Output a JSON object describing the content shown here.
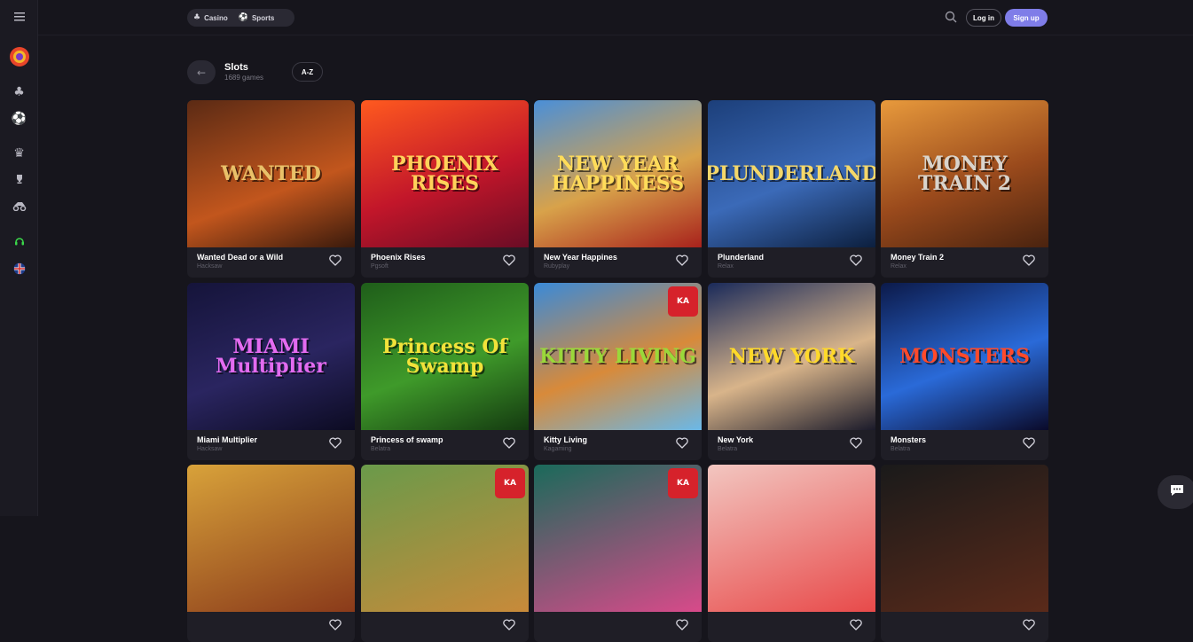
{
  "sidebar": {
    "menu_icon": "hamburger-icon",
    "items": [
      {
        "name": "profile-icon",
        "glyph": "✺"
      },
      {
        "name": "casino-icon",
        "glyph": "♣"
      },
      {
        "name": "football-icon",
        "glyph": "⚽"
      },
      {
        "name": "crown-icon",
        "glyph": "♛"
      },
      {
        "name": "trophy-icon",
        "glyph": "🏆"
      },
      {
        "name": "race-icon",
        "glyph": "⛍"
      },
      {
        "name": "support-icon",
        "glyph": "☊"
      },
      {
        "name": "language-flag-icon",
        "glyph": "✚"
      }
    ]
  },
  "header": {
    "nav": [
      {
        "label": "Casino",
        "icon": "casino-icon"
      },
      {
        "label": "Sports",
        "icon": "football-icon"
      }
    ],
    "login_label": "Log in",
    "signup_label": "Sign up"
  },
  "section": {
    "title": "Slots",
    "count": "1689 games",
    "sort_label": "A-Z"
  },
  "games": [
    {
      "name": "Wanted Dead or a Wild",
      "provider": "Hacksaw",
      "art": "WANTED",
      "bg": "linear-gradient(160deg,#5b2a14,#c2561d 60%,#3a1a0c)",
      "fg": "#e9c169"
    },
    {
      "name": "Phoenix Rises",
      "provider": "Pgsoft",
      "art": "PHOENIX RISES",
      "bg": "linear-gradient(160deg,#ff5a1f,#c2162a 55%,#6a0c25)",
      "fg": "#ffd25a"
    },
    {
      "name": "New Year Happines",
      "provider": "Rubyplay",
      "art": "NEW YEAR HAPPINESS",
      "bg": "linear-gradient(160deg,#4a8fd8,#d8a24a 55%,#a8221c)",
      "fg": "#ffdc5a"
    },
    {
      "name": "Plunderland",
      "provider": "Relax",
      "art": "PLUNDERLAND",
      "bg": "linear-gradient(160deg,#1c3f7a,#3b6ab8 55%,#0c1f3e)",
      "fg": "#f4d76a"
    },
    {
      "name": "Money Train 2",
      "provider": "Relax",
      "art": "MONEY TRAIN 2",
      "bg": "linear-gradient(160deg,#e89a3c,#9a4a1c 55%,#4a230f)",
      "fg": "#d9d4cc"
    },
    {
      "name": "Miami Multiplier",
      "provider": "Hacksaw",
      "art": "MIAMI Multiplier",
      "bg": "linear-gradient(160deg,#15143a,#2a2560 55%,#0c0b22)",
      "fg": "#e36bf0"
    },
    {
      "name": "Princess of swamp",
      "provider": "Belatra",
      "art": "Princess Of Swamp",
      "bg": "linear-gradient(160deg,#1f5e1a,#3f9a2a 55%,#143a10)",
      "fg": "#f2e23a"
    },
    {
      "name": "Kitty Living",
      "provider": "Kagaming",
      "art": "KITTY LIVING",
      "bg": "linear-gradient(160deg,#3a8ad8,#d88a3a 55%,#6ab8e8)",
      "fg": "#9ad83a",
      "badge": "KA"
    },
    {
      "name": "New York",
      "provider": "Belatra",
      "art": "NEW YORK",
      "bg": "linear-gradient(160deg,#1a2a5a,#d8b48a 55%,#1a1a2a)",
      "fg": "#ffd92a"
    },
    {
      "name": "Monsters",
      "provider": "Belatra",
      "art": "MONSTERS",
      "bg": "linear-gradient(160deg,#0c1a4a,#2a6ad8 55%,#0a0a2a)",
      "fg": "#ff4a2a"
    },
    {
      "name": "",
      "provider": "",
      "art": "",
      "bg": "linear-gradient(160deg,#d8a23a,#8a3a1a)",
      "fg": "#fff"
    },
    {
      "name": "",
      "provider": "",
      "art": "",
      "bg": "linear-gradient(160deg,#6a9a4a,#c88a3a)",
      "fg": "#fff",
      "badge": "KA"
    },
    {
      "name": "",
      "provider": "",
      "art": "",
      "bg": "linear-gradient(160deg,#1a6a5a,#d84a8a)",
      "fg": "#fff",
      "badge": "KA"
    },
    {
      "name": "",
      "provider": "",
      "art": "",
      "bg": "linear-gradient(160deg,#f2c6c0,#e84a4a)",
      "fg": "#fff"
    },
    {
      "name": "",
      "provider": "",
      "art": "",
      "bg": "linear-gradient(160deg,#1a1a1a,#5a2a1a)",
      "fg": "#fff"
    }
  ],
  "colors": {
    "accent": "#7f7de8",
    "background": "#16151c",
    "card": "#1f1e26"
  },
  "chat_icon": "chat-bubble-icon"
}
